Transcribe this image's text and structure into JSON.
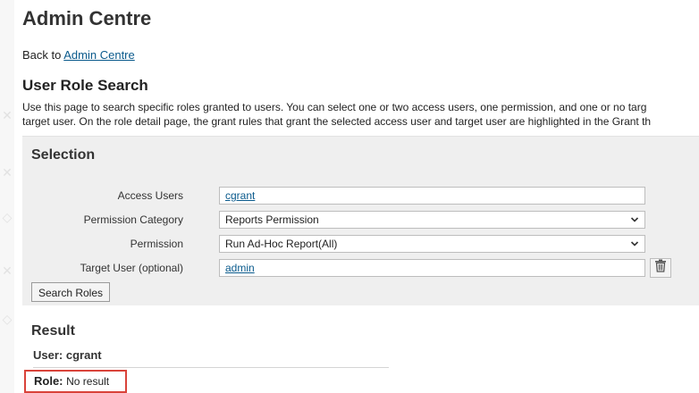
{
  "header": {
    "title": "Admin Centre",
    "back_prefix": "Back to",
    "back_link": "Admin Centre"
  },
  "search": {
    "title": "User Role Search",
    "description_line1": "Use this page to search specific roles granted to users. You can select one or two access users, one permission, and one or no targ",
    "description_line2": "target user. On the role detail page, the grant rules that grant the selected access user and target user are highlighted in the Grant th"
  },
  "selection": {
    "title": "Selection",
    "access_users_label": "Access Users",
    "access_users_value": "cgrant",
    "permission_category_label": "Permission Category",
    "permission_category_value": "Reports Permission",
    "permission_label": "Permission",
    "permission_value": "Run Ad-Hoc Report(All)",
    "target_user_label": "Target User (optional)",
    "target_user_value": "admin",
    "search_button_label": "Search Roles"
  },
  "result": {
    "title": "Result",
    "user_label": "User:",
    "user_value": "cgrant",
    "role_label": "Role:",
    "role_value": "No result"
  },
  "icons": {
    "dropdown": "chevron-down-icon",
    "clear": "trash-icon"
  },
  "colors": {
    "link": "#0a5a8c",
    "panel_background": "#efefef",
    "highlight_border": "#d9433a"
  }
}
